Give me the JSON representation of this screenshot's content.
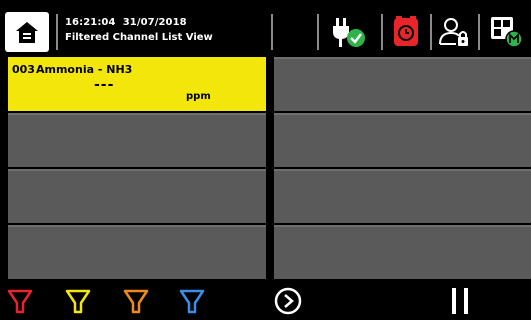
{
  "header": {
    "time": "16:21:04",
    "date": "31/07/2018",
    "subtitle": "Filtered Channel List View",
    "icons": [
      "home-icon",
      "power-ok-icon",
      "alarm-clock-icon",
      "user-lock-icon",
      "layout-settings-icon"
    ],
    "colors": {
      "alarm": "#e8262a",
      "ok": "#2db34a"
    }
  },
  "channels": [
    {
      "number": "003",
      "name": "Ammonia - NH3",
      "value": "---",
      "unit": "ppm",
      "color": "#f2e60a"
    },
    {
      "number": "",
      "name": "",
      "value": "",
      "unit": ""
    },
    {
      "number": "",
      "name": "",
      "value": "",
      "unit": ""
    },
    {
      "number": "",
      "name": "",
      "value": "",
      "unit": ""
    },
    {
      "number": "",
      "name": "",
      "value": "",
      "unit": ""
    },
    {
      "number": "",
      "name": "",
      "value": "",
      "unit": ""
    },
    {
      "number": "",
      "name": "",
      "value": "",
      "unit": ""
    },
    {
      "number": "",
      "name": "",
      "value": "",
      "unit": ""
    }
  ],
  "footer": {
    "filters": [
      {
        "name": "red-filter-icon",
        "color": "#e8262a"
      },
      {
        "name": "yellow-filter-icon",
        "color": "#f2e60a"
      },
      {
        "name": "orange-filter-icon",
        "color": "#f08a1c"
      },
      {
        "name": "blue-filter-icon",
        "color": "#3a8ee6"
      }
    ],
    "icons": [
      "play-icon",
      "pause-icon"
    ]
  }
}
